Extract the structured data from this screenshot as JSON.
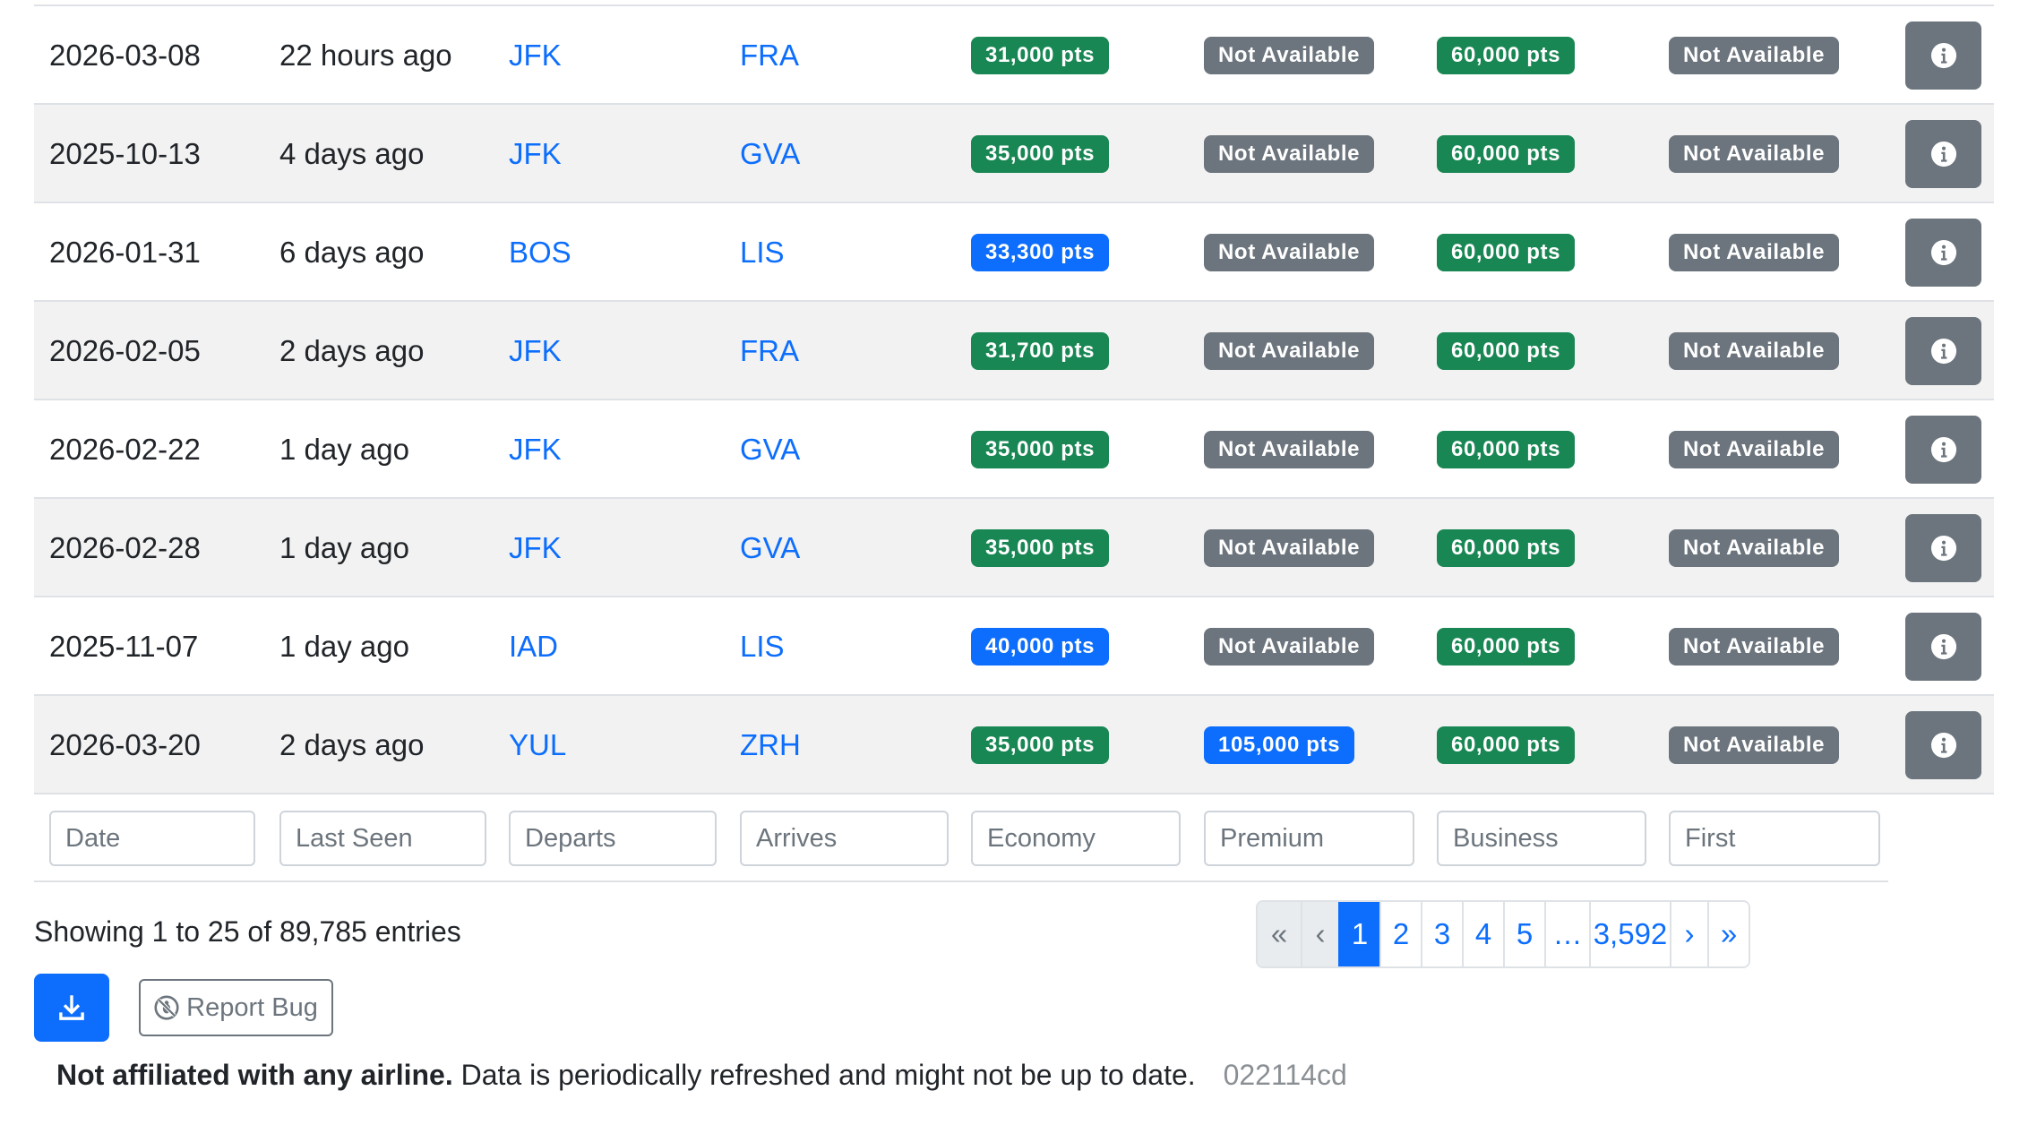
{
  "rows": [
    {
      "date": "2026-03-08",
      "last_seen": "22 hours ago",
      "departs": "JFK",
      "arrives": "FRA",
      "economy": {
        "text": "31,000 pts",
        "color": "green"
      },
      "premium": {
        "text": "Not Available",
        "color": "gray"
      },
      "business": {
        "text": "60,000 pts",
        "color": "green"
      },
      "first": {
        "text": "Not Available",
        "color": "gray"
      }
    },
    {
      "date": "2025-10-13",
      "last_seen": "4 days ago",
      "departs": "JFK",
      "arrives": "GVA",
      "economy": {
        "text": "35,000 pts",
        "color": "green"
      },
      "premium": {
        "text": "Not Available",
        "color": "gray"
      },
      "business": {
        "text": "60,000 pts",
        "color": "green"
      },
      "first": {
        "text": "Not Available",
        "color": "gray"
      }
    },
    {
      "date": "2026-01-31",
      "last_seen": "6 days ago",
      "departs": "BOS",
      "arrives": "LIS",
      "economy": {
        "text": "33,300 pts",
        "color": "blue"
      },
      "premium": {
        "text": "Not Available",
        "color": "gray"
      },
      "business": {
        "text": "60,000 pts",
        "color": "green"
      },
      "first": {
        "text": "Not Available",
        "color": "gray"
      }
    },
    {
      "date": "2026-02-05",
      "last_seen": "2 days ago",
      "departs": "JFK",
      "arrives": "FRA",
      "economy": {
        "text": "31,700 pts",
        "color": "green"
      },
      "premium": {
        "text": "Not Available",
        "color": "gray"
      },
      "business": {
        "text": "60,000 pts",
        "color": "green"
      },
      "first": {
        "text": "Not Available",
        "color": "gray"
      }
    },
    {
      "date": "2026-02-22",
      "last_seen": "1 day ago",
      "departs": "JFK",
      "arrives": "GVA",
      "economy": {
        "text": "35,000 pts",
        "color": "green"
      },
      "premium": {
        "text": "Not Available",
        "color": "gray"
      },
      "business": {
        "text": "60,000 pts",
        "color": "green"
      },
      "first": {
        "text": "Not Available",
        "color": "gray"
      }
    },
    {
      "date": "2026-02-28",
      "last_seen": "1 day ago",
      "departs": "JFK",
      "arrives": "GVA",
      "economy": {
        "text": "35,000 pts",
        "color": "green"
      },
      "premium": {
        "text": "Not Available",
        "color": "gray"
      },
      "business": {
        "text": "60,000 pts",
        "color": "green"
      },
      "first": {
        "text": "Not Available",
        "color": "gray"
      }
    },
    {
      "date": "2025-11-07",
      "last_seen": "1 day ago",
      "departs": "IAD",
      "arrives": "LIS",
      "economy": {
        "text": "40,000 pts",
        "color": "blue"
      },
      "premium": {
        "text": "Not Available",
        "color": "gray"
      },
      "business": {
        "text": "60,000 pts",
        "color": "green"
      },
      "first": {
        "text": "Not Available",
        "color": "gray"
      }
    },
    {
      "date": "2026-03-20",
      "last_seen": "2 days ago",
      "departs": "YUL",
      "arrives": "ZRH",
      "economy": {
        "text": "35,000 pts",
        "color": "green"
      },
      "premium": {
        "text": "105,000 pts",
        "color": "blue"
      },
      "business": {
        "text": "60,000 pts",
        "color": "green"
      },
      "first": {
        "text": "Not Available",
        "color": "gray"
      }
    }
  ],
  "info_icon": "info-circle-icon",
  "filters": {
    "date": "Date",
    "last_seen": "Last Seen",
    "departs": "Departs",
    "arrives": "Arrives",
    "economy": "Economy",
    "premium": "Premium",
    "business": "Business",
    "first": "First"
  },
  "showing_text": "Showing 1 to 25 of 89,785 entries",
  "pagination": [
    {
      "label": "«",
      "state": "disabled"
    },
    {
      "label": "‹",
      "state": "disabled"
    },
    {
      "label": "1",
      "state": "active"
    },
    {
      "label": "2",
      "state": "normal"
    },
    {
      "label": "3",
      "state": "normal"
    },
    {
      "label": "4",
      "state": "normal"
    },
    {
      "label": "5",
      "state": "normal"
    },
    {
      "label": "…",
      "state": "normal"
    },
    {
      "label": "3,592",
      "state": "normal"
    },
    {
      "label": "›",
      "state": "normal"
    },
    {
      "label": "»",
      "state": "normal"
    }
  ],
  "download_icon": "download-icon",
  "report_bug": {
    "icon": "bug-slash-icon",
    "label": "Report Bug"
  },
  "footer": {
    "bold": "Not affiliated with any airline.",
    "text": "Data is periodically refreshed and might not be up to date.",
    "hash": "022114cd"
  },
  "colors": {
    "green": "#198754",
    "blue": "#0d6efd",
    "gray": "#6c757d",
    "link": "#0d6efd",
    "stripe": "#f2f2f2"
  }
}
